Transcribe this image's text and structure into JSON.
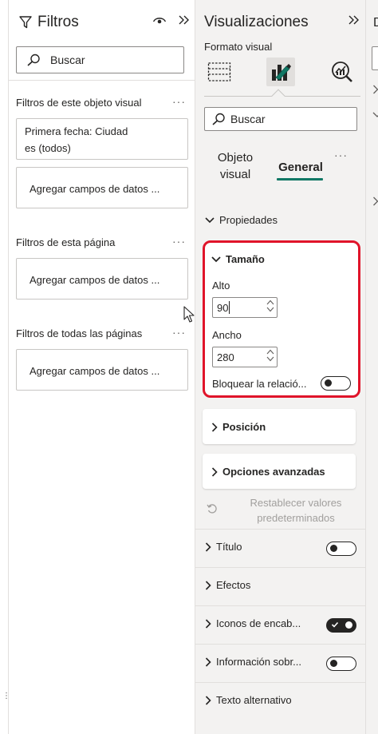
{
  "filters": {
    "title": "Filtros",
    "search_placeholder": "Buscar",
    "this_visual": {
      "title": "Filtros de este objeto visual",
      "more": "···",
      "filter_card_line1": "Primera fecha: Ciudad",
      "filter_card_line2": "es (todos)",
      "add_fields": "Agregar campos de datos ..."
    },
    "this_page": {
      "title": "Filtros de esta página",
      "more": "···",
      "add_fields": "Agregar campos de datos ..."
    },
    "all_pages": {
      "title": "Filtros de todas las páginas",
      "more": "···",
      "add_fields": "Agregar campos de datos ..."
    }
  },
  "visualizations": {
    "title": "Visualizaciones",
    "subheading": "Formato visual",
    "search_placeholder": "Buscar",
    "tabs": [
      {
        "line1": "Objeto",
        "line2": "visual"
      },
      {
        "line1": "General",
        "line2": ""
      }
    ],
    "tabs_more": "···",
    "properties_label": "Propiedades",
    "size": {
      "label": "Tamaño",
      "height_label": "Alto",
      "height_value": "90",
      "width_label": "Ancho",
      "width_value": "280",
      "lock_ratio_label": "Bloquear la relació...",
      "lock_ratio_on": false
    },
    "position_label": "Posición",
    "advanced_label": "Opciones avanzadas",
    "reset_line1": "Restablecer valores",
    "reset_line2": "predeterminados",
    "rows": [
      {
        "label": "Título",
        "toggle": "off"
      },
      {
        "label": "Efectos",
        "toggle": "none"
      },
      {
        "label": "Iconos de encab...",
        "toggle": "on"
      },
      {
        "label": "Información sobr...",
        "toggle": "off"
      },
      {
        "label": "Texto alternativo",
        "toggle": "none"
      }
    ]
  },
  "right_strip": {
    "letter": "D"
  },
  "colors": {
    "accent": "#117865",
    "highlight": "#e0142a",
    "pane_bg": "#f3f2f1"
  }
}
